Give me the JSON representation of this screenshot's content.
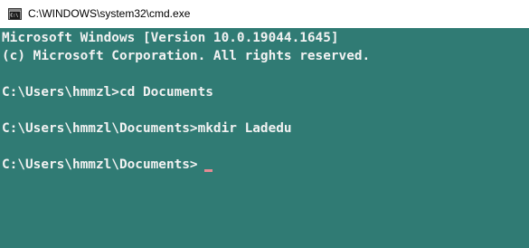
{
  "window": {
    "title": "C:\\WINDOWS\\system32\\cmd.exe",
    "icon": "console-icon"
  },
  "console": {
    "lines": [
      "Microsoft Windows [Version 10.0.19044.1645]",
      "(c) Microsoft Corporation. All rights reserved.",
      "C:\\Users\\hmmzl>cd Documents",
      "C:\\Users\\hmmzl\\Documents>mkdir Ladedu",
      "C:\\Users\\hmmzl\\Documents>"
    ],
    "background_color": "#307b74",
    "text_color": "#f2f2f2",
    "cursor_color": "#e48a93"
  }
}
